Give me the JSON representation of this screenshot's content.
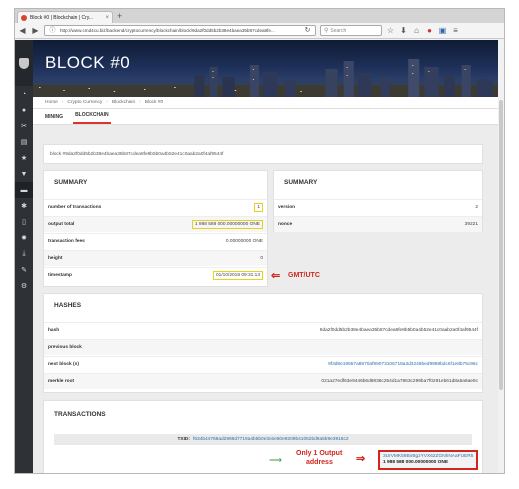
{
  "browser": {
    "tab_title": "Block #0 | Blockchain | Cry...",
    "tab_close": "×",
    "new_tab": "+",
    "url": "http://www.cmd4cu.biz/backend/cryptocurrency/blockchain/block/9da2f0dd5b2b38e4baea35b87cdea8fe...",
    "search_placeholder": "Search",
    "icons": [
      "back-icon",
      "forward-icon",
      "reload-icon",
      "home-icon",
      "bookmark-icon",
      "menu-icon"
    ]
  },
  "sidebar": {
    "items": [
      "user-icon",
      "tools-icon",
      "layers-icon",
      "star-icon",
      "cart-icon",
      "wallet-icon",
      "asterisk-icon",
      "doc-icon",
      "gear-icon",
      "download-icon",
      "pen-icon",
      "settings-icon"
    ]
  },
  "page": {
    "title": "BLOCK #0",
    "breadcrumbs": [
      "Home",
      "Crypto Currency",
      "Blockchain",
      "Block #0"
    ],
    "tabs": [
      "MINING",
      "BLOCKCHAIN"
    ],
    "block_hash_line": "block #9da2f0dd5b2b38e4baea35b87cdea8fe8b5b0a4b52e41c0aab2a0f4af9544f"
  },
  "summary_left": {
    "title": "SUMMARY",
    "rows": [
      {
        "label": "number of transactions",
        "value": "1"
      },
      {
        "label": "output total",
        "value": "1 988 588 000.00000000 ONE"
      },
      {
        "label": "transaction fees",
        "value": "0.00000000 ONE"
      },
      {
        "label": "height",
        "value": "0"
      },
      {
        "label": "timestamp",
        "value": "01/10/2018 09:31:13"
      }
    ]
  },
  "summary_right": {
    "title": "SUMMARY",
    "rows": [
      {
        "label": "version",
        "value": "2"
      },
      {
        "label": "nonce",
        "value": "39221"
      }
    ]
  },
  "annotations": {
    "timestamp_note": "GMT/UTC",
    "output_note_line1": "Only 1 Output",
    "output_note_line2": "address"
  },
  "hashes": {
    "title": "HASHES",
    "rows": [
      {
        "label": "hash",
        "value": "9da2f0dd5b2b38e4baea35b87cdea8fe8b5b0a4b52e41c0aab2a0f4af9544f"
      },
      {
        "label": "previous block",
        "value": ""
      },
      {
        "label": "next block (s)",
        "value": "9f3d8e19557a8870af99073106718a3d3249bed9988bdc6f1e8b75c96c"
      },
      {
        "label": "merkle root",
        "value": "021a27edf63e9446b6d8836c254d1a7863c299ba7f0291eb61d8a5a9ae9c"
      }
    ]
  },
  "transactions": {
    "title": "TRANSACTIONS",
    "txid_label": "TXID:",
    "txid_value": "f634b44768ad2998d7719a4b5b0e3c6e50e9209b41052bd9a5b9e3916c2",
    "output_address": "3UrVMK59BnBgzYVX62ZGNhNAaFUER5",
    "output_amount": "1 988 588 000.00000000 ONE"
  }
}
